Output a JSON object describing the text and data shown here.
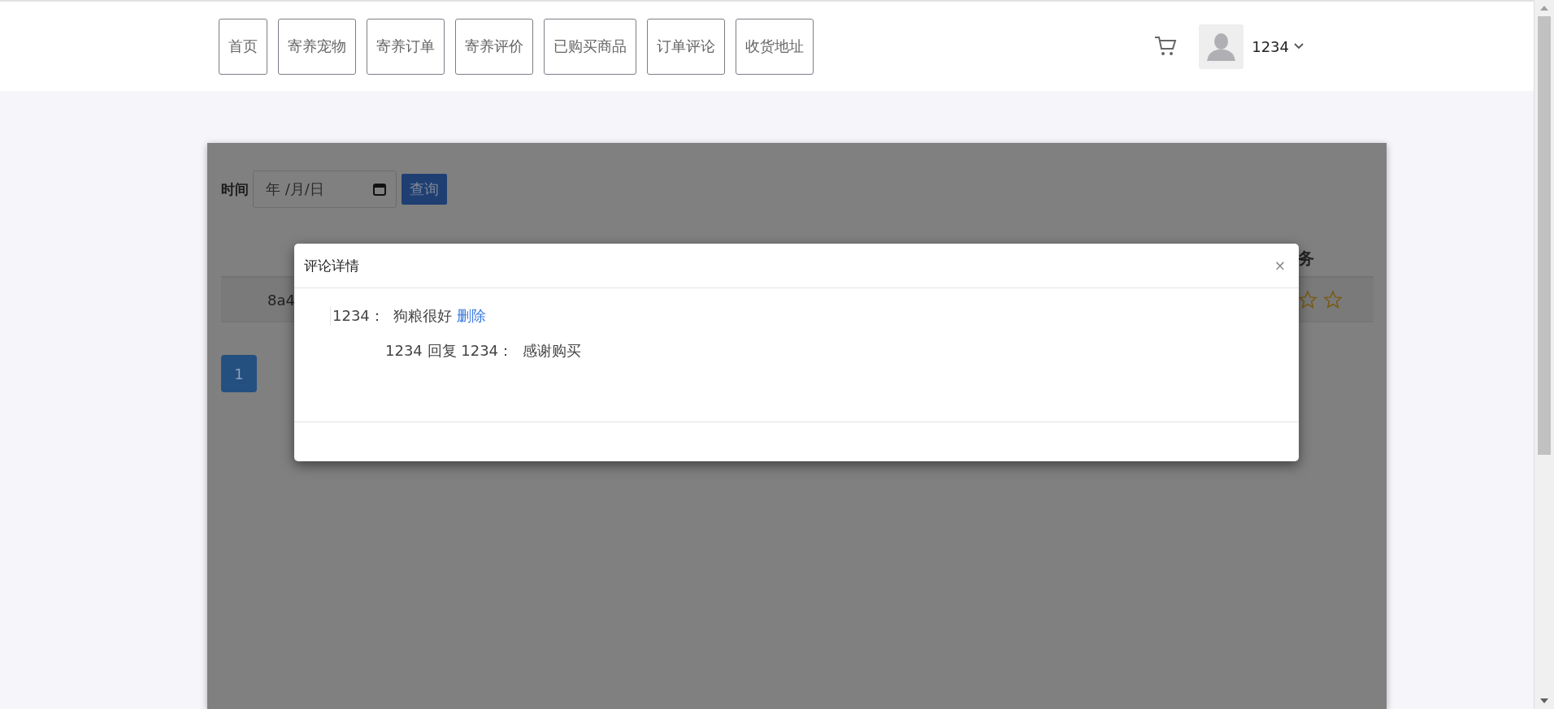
{
  "nav": {
    "items": [
      {
        "label": "首页"
      },
      {
        "label": "寄养宠物"
      },
      {
        "label": "寄养订单"
      },
      {
        "label": "寄养评价"
      },
      {
        "label": "已购买商品"
      },
      {
        "label": "订单评论"
      },
      {
        "label": "收货地址"
      }
    ],
    "user": {
      "name": "1234"
    }
  },
  "filter": {
    "label": "时间",
    "date_placeholder": "年 /月/日",
    "button": "查询"
  },
  "table": {
    "header_last": "务",
    "rows": [
      {
        "first": "8a4",
        "rating_stars": [
          {
            "filled": false
          },
          {
            "filled": false
          }
        ]
      }
    ]
  },
  "pagination": [
    {
      "label": "1",
      "selected": true
    }
  ],
  "modal": {
    "title": "评论详情",
    "close": "×",
    "comments": [
      {
        "text": "1234：  狗粮很好",
        "delete_link": "删除",
        "replies": [
          {
            "text": "1234 回复 1234：  感谢购买"
          }
        ]
      }
    ]
  }
}
